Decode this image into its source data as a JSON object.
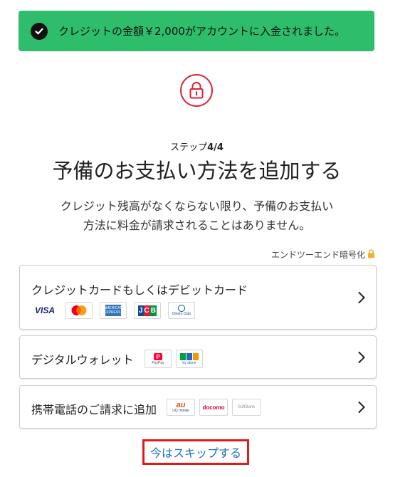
{
  "banner": {
    "message": "クレジットの金額￥2,000がアカウントに入金されました。",
    "icon": "check-circle-icon",
    "color": "#2ebd6b"
  },
  "lock_icon": "lock-icon",
  "step": {
    "prefix": "ステップ",
    "value": "4/4"
  },
  "title": "予備のお支払い方法を追加する",
  "description": {
    "line1": "クレジット残高がなくならない限り、予備のお支払い",
    "line2": "方法に料金が請求されることはありません。"
  },
  "encryption": {
    "label": "エンドツーエンド暗号化",
    "icon": "padlock-icon"
  },
  "options": {
    "card": {
      "label": "クレジットカードもしくはデビットカード",
      "logos": {
        "visa": "VISA",
        "amex": "AMERICAN EXPRESS",
        "jcb": [
          "J",
          "C",
          "B"
        ],
        "diners": "Diners Club"
      }
    },
    "wallet": {
      "label": "デジタルウォレット",
      "logos": {
        "paypay": "PayPay",
        "atone": "by atone"
      }
    },
    "phone": {
      "label": "携帯電話のご請求に追加",
      "logos": {
        "au": "au",
        "uq": "UQ mobile",
        "docomo": "docomo",
        "softbank": "SoftBank"
      }
    }
  },
  "skip_link": "今はスキップする",
  "colors": {
    "accent_red": "#d9253a",
    "link_blue": "#1a6fc2",
    "highlight_red": "#e01b1b"
  }
}
